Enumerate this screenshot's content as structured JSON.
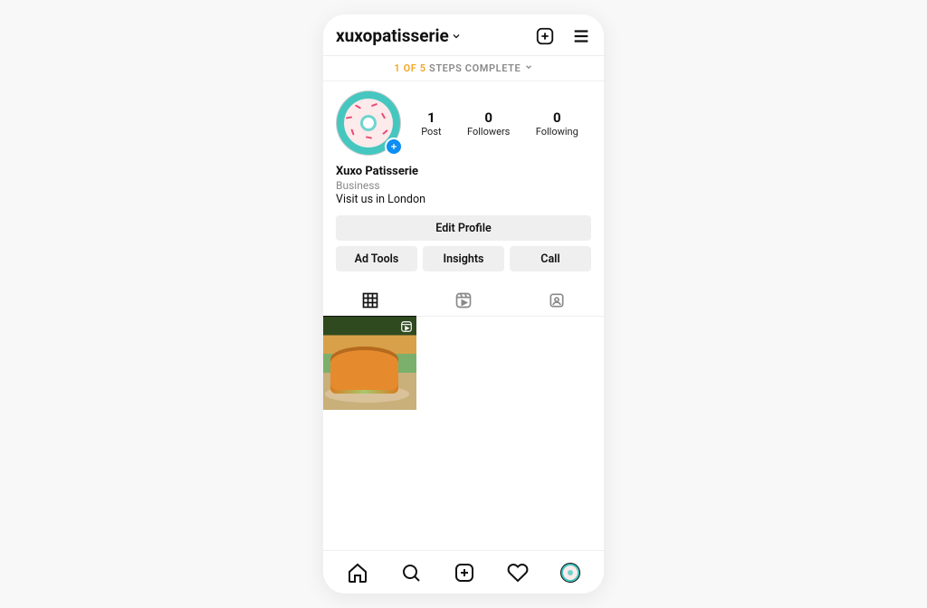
{
  "header": {
    "username": "xuxopatisserie"
  },
  "steps": {
    "count": "1 OF 5",
    "label": "STEPS COMPLETE"
  },
  "stats": [
    {
      "num": "1",
      "label": "Post"
    },
    {
      "num": "0",
      "label": "Followers"
    },
    {
      "num": "0",
      "label": "Following"
    }
  ],
  "bio": {
    "name": "Xuxo Patisserie",
    "category": "Business",
    "description": "Visit us in London"
  },
  "buttons": {
    "edit": "Edit Profile",
    "ad_tools": "Ad Tools",
    "insights": "Insights",
    "call": "Call"
  }
}
